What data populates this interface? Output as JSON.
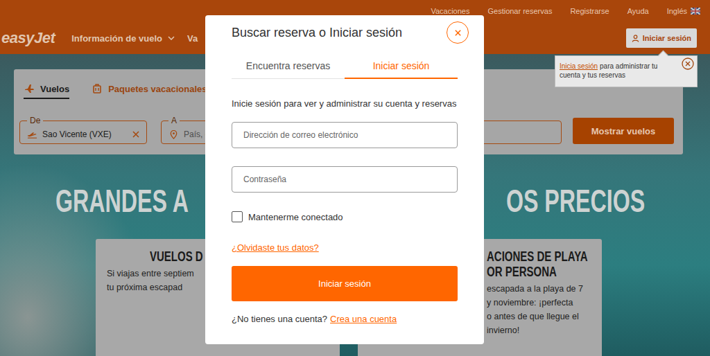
{
  "top_bar": {
    "links": [
      "Vacaciones",
      "Gestionar reservas",
      "Registrarse",
      "Ayuda"
    ],
    "language": "Inglés"
  },
  "nav": {
    "logo": "easyJet",
    "items": [
      {
        "label": "Información de vuelo",
        "has_dropdown": true
      },
      {
        "label": "Va",
        "has_dropdown": false
      }
    ],
    "login_button": "Iniciar sesión"
  },
  "tooltip": {
    "link": "Inicia sesión",
    "text": "para administrar tu cuenta y tus reservas"
  },
  "search": {
    "tabs": [
      {
        "label": "Vuelos",
        "selected": true
      },
      {
        "label": "Paquetes vacacionales",
        "selected": false
      }
    ],
    "fields": [
      {
        "label": "De",
        "text": "Sao Vicente (VXE)",
        "kind": "filled"
      },
      {
        "label": "A",
        "text": "País, ci",
        "kind": "empty"
      }
    ],
    "button": "Mostrar vuelos"
  },
  "hero": {
    "title_left": "GRANDES A",
    "title_right": "OS PRECIOS"
  },
  "cards": [
    {
      "title": [
        "VUELOS D"
      ],
      "lines": [
        "Si viajas entre septiem",
        "tu próxima escapad"
      ]
    },
    {
      "title": [
        "ACIONES DE PLAYA",
        "OR PERSONA"
      ],
      "lines": [
        "escapada a la playa de 7",
        "y noviembre: ¡perfecta",
        "o antes de que llegue el",
        "invierno!"
      ]
    }
  ],
  "modal": {
    "title": "Buscar reserva o Iniciar sesión",
    "tabs": [
      {
        "label": "Encuentra reservas",
        "selected": false
      },
      {
        "label": "Iniciar sesión",
        "selected": true
      }
    ],
    "intro": "Inicie sesión para ver y administrar su cuenta y reservas",
    "fields": [
      {
        "placeholder": "Dirección de correo electrónico"
      },
      {
        "placeholder": "Contraseña"
      }
    ],
    "remember": {
      "label": "Mantenerme conectado",
      "checked": false
    },
    "forgot_link": "¿Olvidaste tus datos?",
    "submit": "Iniciar sesión",
    "signup": {
      "text": "¿No tienes una cuenta?",
      "link": "Crea una cuenta"
    }
  }
}
